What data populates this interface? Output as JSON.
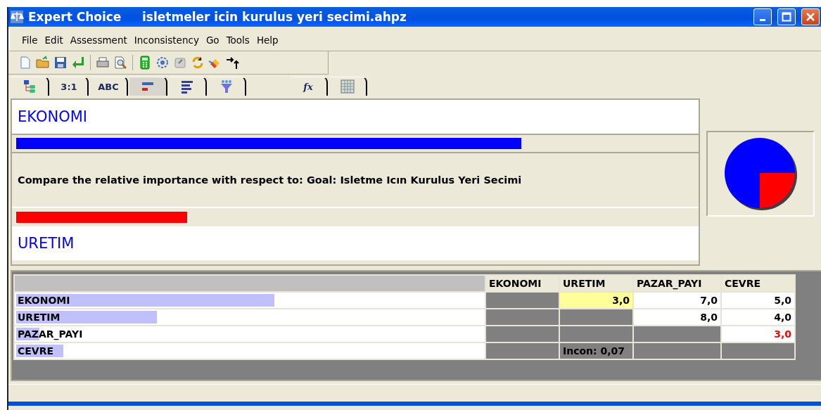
{
  "window": {
    "title": "Expert Choice     isletmeler icin kurulus yeri secimi.ahpz"
  },
  "menu": [
    "File",
    "Edit",
    "Assessment",
    "Inconsistency",
    "Go",
    "Tools",
    "Help"
  ],
  "tabs": [
    {
      "kind": "tree",
      "selected": false
    },
    {
      "kind": "text",
      "label": "3:1",
      "selected": false
    },
    {
      "kind": "text",
      "label": "ABC",
      "selected": false
    },
    {
      "kind": "pair-bars",
      "selected": true
    },
    {
      "kind": "bars",
      "selected": false
    },
    {
      "kind": "funnel",
      "selected": false
    },
    {
      "kind": "formula",
      "label": "fx",
      "selected": false
    },
    {
      "kind": "grid",
      "selected": false
    }
  ],
  "comparison": {
    "question": "Compare the relative importance with respect to: Goal: Isletme Icın Kurulus Yeri Secimi",
    "elements": [
      {
        "name": "EKONOMI",
        "level": 0.74
      },
      {
        "name": "URETIM"
      }
    ]
  },
  "matrix": {
    "columns": [
      "EKONOMI",
      "URETIM",
      "PAZAR_PAYI",
      "CEVRE"
    ],
    "rows": [
      {
        "name": "EKONOMI",
        "level": 0.55,
        "cells": [
          {
            "kind": "shaded"
          },
          {
            "kind": "value",
            "text": "3,0",
            "selected": true,
            "inverted": false
          },
          {
            "kind": "value",
            "text": "7,0",
            "selected": false,
            "inverted": false
          },
          {
            "kind": "value",
            "text": "5,0",
            "selected": false,
            "inverted": false
          }
        ]
      },
      {
        "name": "URETIM",
        "level": 0.3,
        "cells": [
          {
            "kind": "shaded"
          },
          {
            "kind": "shaded"
          },
          {
            "kind": "value",
            "text": "8,0",
            "selected": false,
            "inverted": false
          },
          {
            "kind": "value",
            "text": "4,0",
            "selected": false,
            "inverted": false
          }
        ]
      },
      {
        "name": "PAZAR_PAYI",
        "level": 0.05,
        "cells": [
          {
            "kind": "shaded"
          },
          {
            "kind": "shaded"
          },
          {
            "kind": "shaded"
          },
          {
            "kind": "value",
            "text": "3,0",
            "selected": false,
            "inverted": true
          }
        ]
      },
      {
        "name": "CEVRE",
        "level": 0.1,
        "cells": [
          {
            "kind": "shaded"
          },
          {
            "kind": "shaded",
            "text": "Incon: 0,07"
          },
          {
            "kind": "shaded"
          },
          {
            "kind": "shaded"
          }
        ]
      }
    ]
  }
}
